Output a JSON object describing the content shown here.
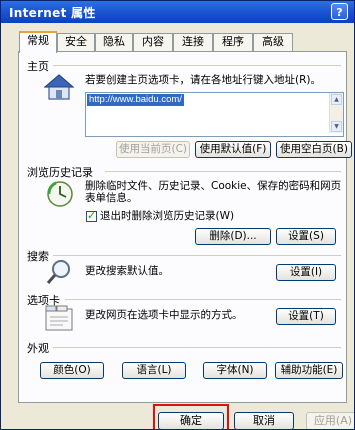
{
  "window": {
    "title": "Internet 属性",
    "help_label": "?"
  },
  "tabs": [
    {
      "label": "常规",
      "active": true
    },
    {
      "label": "安全",
      "active": false
    },
    {
      "label": "隐私",
      "active": false
    },
    {
      "label": "内容",
      "active": false
    },
    {
      "label": "连接",
      "active": false
    },
    {
      "label": "程序",
      "active": false
    },
    {
      "label": "高级",
      "active": false
    }
  ],
  "home": {
    "heading": "主页",
    "description": "若要创建主页选项卡，请在各地址行键入地址(R)。",
    "url": "http://www.baidu.com/",
    "buttons": {
      "use_current": "使用当前页(C)",
      "use_default": "使用默认值(F)",
      "use_blank": "使用空白页(B)"
    }
  },
  "history": {
    "heading": "浏览历史记录",
    "description_line1": "删除临时文件、历史记录、Cookie、保存的密码和网页",
    "description_line2": "表单信息。",
    "checkbox_label": "退出时删除浏览历史记录(W)",
    "checkbox_checked": true,
    "delete_button": "删除(D)...",
    "settings_button": "设置(S)"
  },
  "search": {
    "heading": "搜索",
    "description": "更改搜索默认值。",
    "settings_button": "设置(I)"
  },
  "tabs_section": {
    "heading": "选项卡",
    "description": "更改网页在选项卡中显示的方式。",
    "settings_button": "设置(T)"
  },
  "appearance": {
    "heading": "外观",
    "buttons": {
      "colors": "颜色(O)",
      "languages": "语言(L)",
      "fonts": "字体(N)",
      "accessibility": "辅助功能(E)"
    }
  },
  "footer": {
    "ok": "确定",
    "cancel": "取消",
    "apply": "应用(A)"
  },
  "colors": {
    "titlebar": "#0b41c2",
    "active_tab_accent": "#e6a23c",
    "selection": "#316ac5",
    "highlight_box": "#e10f0f",
    "dialog_bg": "#ece9d8"
  }
}
